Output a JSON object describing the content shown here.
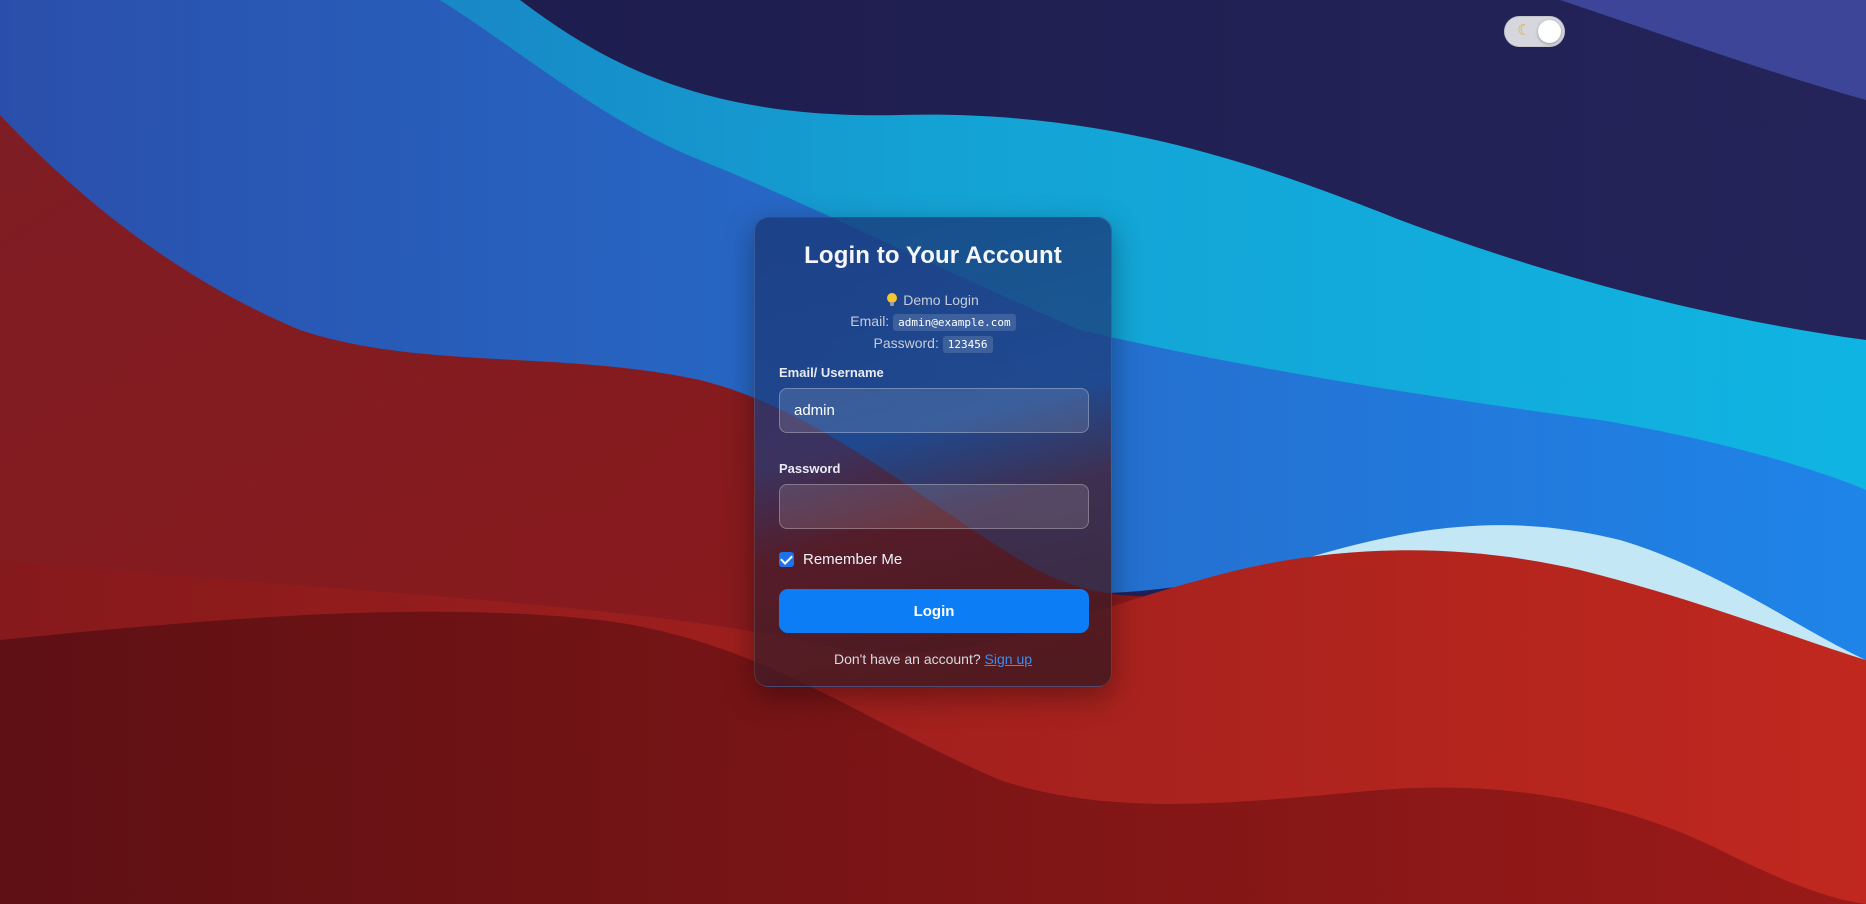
{
  "theme_toggle": {
    "icon": "moon-icon",
    "state": "on"
  },
  "login": {
    "title": "Login to Your Account",
    "demo": {
      "heading": "Demo Login",
      "email_label": "Email:",
      "email_value": "admin@example.com",
      "password_label": "Password:",
      "password_value": "123456"
    },
    "email_field": {
      "label": "Email/ Username",
      "value": "admin"
    },
    "password_field": {
      "label": "Password",
      "value": ""
    },
    "remember": {
      "label": "Remember Me",
      "checked": true
    },
    "submit_label": "Login",
    "signup_prompt": "Don't have an account?",
    "signup_link": "Sign up"
  },
  "colors": {
    "accent": "#0d7df6",
    "link": "#3b8df5"
  }
}
